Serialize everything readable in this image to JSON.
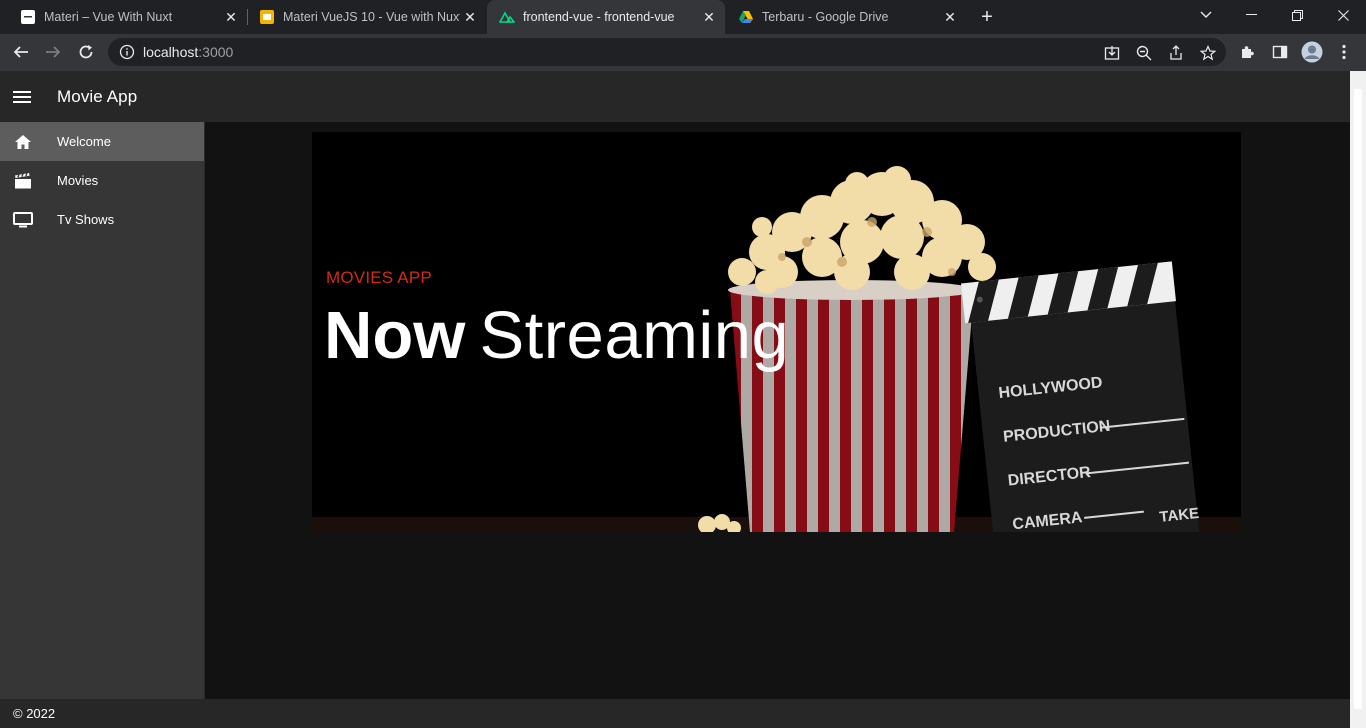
{
  "browser": {
    "tabs": [
      {
        "title": "Materi – Vue With Nuxt",
        "active": false
      },
      {
        "title": "Materi VueJS 10 - Vue with Nuxt",
        "active": false
      },
      {
        "title": "frontend-vue - frontend-vue",
        "active": true
      },
      {
        "title": "Terbaru - Google Drive",
        "active": false
      }
    ],
    "url_host": "localhost",
    "url_port": ":3000"
  },
  "app": {
    "title": "Movie App",
    "nav": [
      {
        "label": "Welcome",
        "icon": "home-icon",
        "active": true
      },
      {
        "label": "Movies",
        "icon": "clapperboard-icon",
        "active": false
      },
      {
        "label": "Tv Shows",
        "icon": "tv-icon",
        "active": false
      }
    ],
    "hero": {
      "kicker": "MOVIES APP",
      "heading_bold": "Now",
      "heading_light": "Streaming"
    },
    "footer": "© 2022"
  },
  "colors": {
    "accent": "#d22c16",
    "appbar": "#272727",
    "drawer": "#363636",
    "content": "#121212"
  }
}
